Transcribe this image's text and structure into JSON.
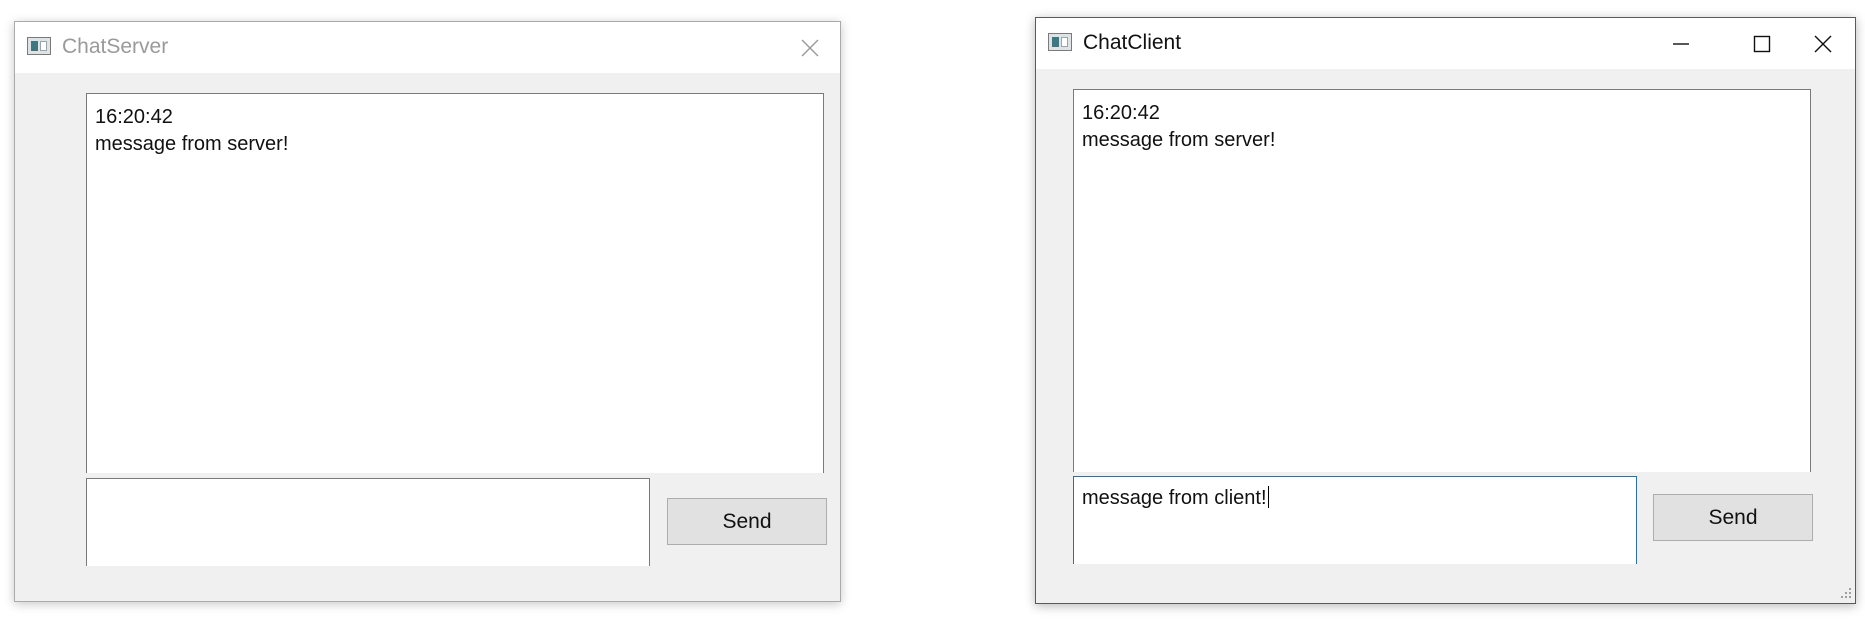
{
  "server": {
    "title": "ChatServer",
    "icon": "app-window-icon",
    "controls": [
      "close-icon"
    ],
    "messages": [
      {
        "time": "16:20:42",
        "text": "message from server!"
      }
    ],
    "input_value": "",
    "send_label": "Send"
  },
  "client": {
    "title": "ChatClient",
    "icon": "app-window-icon",
    "controls": [
      "minimize-icon",
      "maximize-icon",
      "close-icon"
    ],
    "messages": [
      {
        "time": "16:20:42",
        "text": "message from server!"
      }
    ],
    "input_value": "message from client!",
    "send_label": "Send"
  },
  "colors": {
    "window_bg": "#f0f0f0",
    "titlebar_bg": "#ffffff",
    "inactive_title": "#9a9a9a",
    "active_title": "#111111",
    "focus_border": "#2a6fb0",
    "button_bg": "#e1e1e1"
  }
}
